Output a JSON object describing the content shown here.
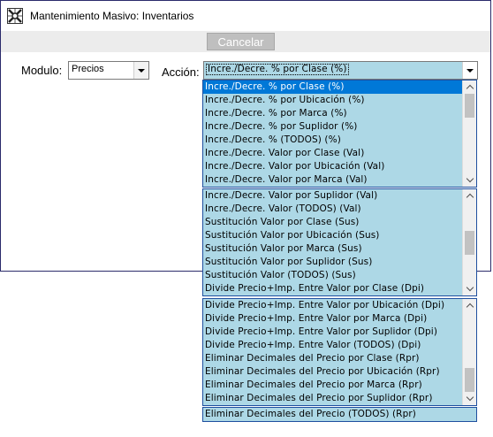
{
  "window": {
    "title": "Mantenimiento Masivo: Inventarios"
  },
  "toolbar": {
    "cancel_label": "Cancelar"
  },
  "form": {
    "modulo_label": "Modulo:",
    "modulo_value": "Precios",
    "accion_label": "Acción:",
    "accion_value": "Incre./Decre. % por Clase (%)"
  },
  "dropdowns": [
    {
      "items": [
        "Incre./Decre. % por Clase (%)",
        "Incre./Decre. % por Ubicación (%)",
        "Incre./Decre. % por Marca (%)",
        "Incre./Decre. % por Suplidor (%)",
        "Incre./Decre. % (TODOS) (%)",
        "Incre./Decre. Valor por Clase (Val)",
        "Incre./Decre. Valor por Ubicación (Val)",
        "Incre./Decre. Valor por Marca (Val)"
      ],
      "selected_index": 0,
      "scroll_position": 0.0
    },
    {
      "items": [
        "Incre./Decre. Valor por Suplidor (Val)",
        "Incre./Decre. Valor (TODOS) (Val)",
        "Sustitución Valor por Clase (Sus)",
        "Sustitución Valor por Ubicación (Sus)",
        "Sustitución Valor por Marca (Sus)",
        "Sustitución Valor por Suplidor (Sus)",
        "Sustitución Valor (TODOS) (Sus)",
        "Divide Precio+Imp. Entre Valor por Clase (Dpi)"
      ],
      "selected_index": -1,
      "scroll_position": 0.5
    },
    {
      "items": [
        "Divide Precio+Imp. Entre Valor por Ubicación (Dpi)",
        "Divide Precio+Imp. Entre Valor por Marca (Dpi)",
        "Divide Precio+Imp. Entre Valor por Suplidor (Dpi)",
        "Divide Precio+Imp. Entre Valor (TODOS) (Dpi)",
        "Eliminar Decimales del Precio por Clase (Rpr)",
        "Eliminar Decimales del Precio por Ubicación (Rpr)",
        "Eliminar Decimales del Precio por Marca (Rpr)",
        "Eliminar Decimales del Precio por Suplidor (Rpr)"
      ],
      "selected_index": -1,
      "scroll_position": 1.0
    }
  ],
  "bottom_combo": {
    "value": "Eliminar Decimales del Precio (TODOS) (Rpr)"
  },
  "colors": {
    "list_background": "#add8e6",
    "selection": "#0078d7",
    "list_border": "#1f4f9f"
  }
}
